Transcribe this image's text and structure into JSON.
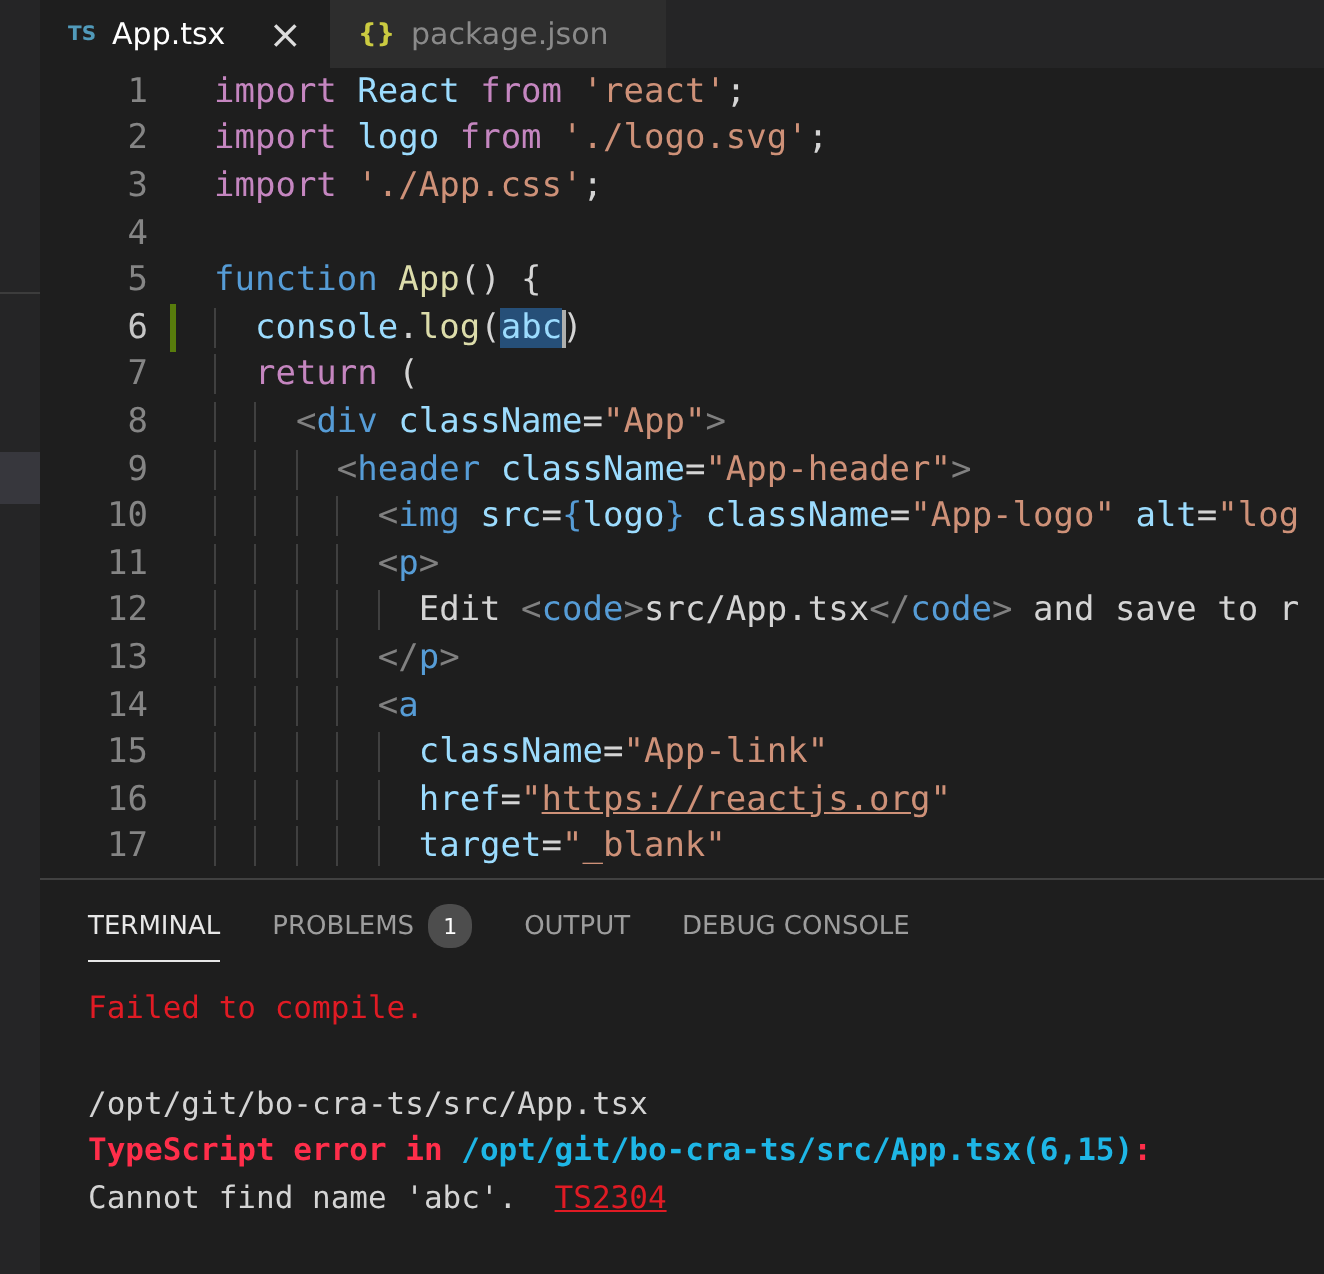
{
  "editor_tabs": [
    {
      "icon": "TS",
      "label": "App.tsx",
      "selected": true,
      "close": "×"
    },
    {
      "icon": "{}",
      "label": "package.json",
      "selected": false
    }
  ],
  "code_lines": [
    {
      "number": "1",
      "current": false,
      "modified": false,
      "tokens": [
        {
          "kind": "keyword",
          "text": "import"
        },
        {
          "kind": "variable",
          "text": " React"
        },
        {
          "kind": "keyword",
          "text": " from"
        },
        {
          "kind": "string",
          "text": " 'react'"
        },
        {
          "kind": "plain",
          "text": ";"
        }
      ]
    },
    {
      "number": "2",
      "current": false,
      "modified": false,
      "tokens": [
        {
          "kind": "keyword",
          "text": "import"
        },
        {
          "kind": "variable",
          "text": " logo"
        },
        {
          "kind": "keyword",
          "text": " from"
        },
        {
          "kind": "string",
          "text": " './logo.svg'"
        },
        {
          "kind": "plain",
          "text": ";"
        }
      ]
    },
    {
      "number": "3",
      "current": false,
      "modified": false,
      "tokens": [
        {
          "kind": "keyword",
          "text": "import"
        },
        {
          "kind": "string",
          "text": " './App.css'"
        },
        {
          "kind": "plain",
          "text": ";"
        }
      ]
    },
    {
      "number": "4",
      "current": false,
      "modified": false
    },
    {
      "number": "5",
      "current": false,
      "modified": false,
      "tokens": [
        {
          "kind": "storage",
          "text": "function"
        },
        {
          "kind": "function",
          "text": " App"
        },
        {
          "kind": "plain",
          "text": "() {"
        }
      ]
    },
    {
      "number": "6",
      "current": true,
      "modified": true,
      "tokens": [
        {
          "kind": "variable",
          "text": "  console"
        },
        {
          "kind": "plain",
          "text": "."
        },
        {
          "kind": "function",
          "text": "log"
        },
        {
          "kind": "plain",
          "text": "("
        },
        {
          "kind": "selection",
          "text": "abc"
        },
        {
          "kind": "plain",
          "text": ")"
        }
      ]
    },
    {
      "number": "7",
      "current": false,
      "modified": false,
      "tokens": [
        {
          "kind": "keyword",
          "text": "  return"
        },
        {
          "kind": "plain",
          "text": " ("
        }
      ]
    },
    {
      "number": "8",
      "current": false,
      "modified": false,
      "tokens": [
        {
          "kind": "punct",
          "text": "    <"
        },
        {
          "kind": "tag",
          "text": "div"
        },
        {
          "kind": "attr",
          "text": " className"
        },
        {
          "kind": "plain",
          "text": "="
        },
        {
          "kind": "string",
          "text": "\"App\""
        },
        {
          "kind": "punct",
          "text": ">"
        }
      ]
    },
    {
      "number": "9",
      "current": false,
      "modified": false,
      "tokens": [
        {
          "kind": "punct",
          "text": "      <"
        },
        {
          "kind": "tag",
          "text": "header"
        },
        {
          "kind": "attr",
          "text": " className"
        },
        {
          "kind": "plain",
          "text": "="
        },
        {
          "kind": "string",
          "text": "\"App-header\""
        },
        {
          "kind": "punct",
          "text": ">"
        }
      ]
    },
    {
      "number": "10",
      "current": false,
      "modified": false,
      "tokens": [
        {
          "kind": "punct",
          "text": "        <"
        },
        {
          "kind": "tag",
          "text": "img"
        },
        {
          "kind": "attr",
          "text": " src"
        },
        {
          "kind": "plain",
          "text": "="
        },
        {
          "kind": "tag",
          "text": "{"
        },
        {
          "kind": "variable",
          "text": "logo"
        },
        {
          "kind": "tag",
          "text": "}"
        },
        {
          "kind": "attr",
          "text": " className"
        },
        {
          "kind": "plain",
          "text": "="
        },
        {
          "kind": "string",
          "text": "\"App-logo\""
        },
        {
          "kind": "attr",
          "text": " alt"
        },
        {
          "kind": "plain",
          "text": "="
        },
        {
          "kind": "string",
          "text": "\"log"
        }
      ]
    },
    {
      "number": "11",
      "current": false,
      "modified": false,
      "tokens": [
        {
          "kind": "punct",
          "text": "        <"
        },
        {
          "kind": "tag",
          "text": "p"
        },
        {
          "kind": "punct",
          "text": ">"
        }
      ]
    },
    {
      "number": "12",
      "current": false,
      "modified": false,
      "tokens": [
        {
          "kind": "plain",
          "text": "          Edit "
        },
        {
          "kind": "punct",
          "text": "<"
        },
        {
          "kind": "tag",
          "text": "code"
        },
        {
          "kind": "punct",
          "text": ">"
        },
        {
          "kind": "plain",
          "text": "src/App.tsx"
        },
        {
          "kind": "punct",
          "text": "</"
        },
        {
          "kind": "tag",
          "text": "code"
        },
        {
          "kind": "punct",
          "text": ">"
        },
        {
          "kind": "plain",
          "text": " and save to r"
        }
      ]
    },
    {
      "number": "13",
      "current": false,
      "modified": false,
      "tokens": [
        {
          "kind": "punct",
          "text": "        </"
        },
        {
          "kind": "tag",
          "text": "p"
        },
        {
          "kind": "punct",
          "text": ">"
        }
      ]
    },
    {
      "number": "14",
      "current": false,
      "modified": false,
      "tokens": [
        {
          "kind": "punct",
          "text": "        <"
        },
        {
          "kind": "tag",
          "text": "a"
        }
      ]
    },
    {
      "number": "15",
      "current": false,
      "modified": false,
      "tokens": [
        {
          "kind": "attr",
          "text": "          className"
        },
        {
          "kind": "plain",
          "text": "="
        },
        {
          "kind": "string",
          "text": "\"App-link\""
        }
      ]
    },
    {
      "number": "16",
      "current": false,
      "modified": false,
      "tokens": [
        {
          "kind": "attr",
          "text": "          href"
        },
        {
          "kind": "plain",
          "text": "="
        },
        {
          "kind": "string",
          "text": "\""
        },
        {
          "kind": "link",
          "text": "https://reactjs.org"
        },
        {
          "kind": "string",
          "text": "\""
        }
      ]
    },
    {
      "number": "17",
      "current": false,
      "modified": false,
      "tokens": [
        {
          "kind": "attr",
          "text": "          target"
        },
        {
          "kind": "plain",
          "text": "="
        },
        {
          "kind": "string",
          "text": "\"_blank\""
        }
      ]
    }
  ],
  "panel_tabs": [
    {
      "label": "TERMINAL",
      "selected": true
    },
    {
      "label": "PROBLEMS",
      "selected": false,
      "badge": "1"
    },
    {
      "label": "OUTPUT",
      "selected": false
    },
    {
      "label": "DEBUG CONSOLE",
      "selected": false
    }
  ],
  "terminal_blocks": [
    {
      "lines": [
        {
          "segments": [
            {
              "kind": "error",
              "text": "Failed to compile."
            }
          ]
        }
      ]
    },
    {
      "lines": [
        {
          "segments": [
            {
              "kind": "plain",
              "text": "/opt/git/bo-cra-ts/src/App.tsx"
            }
          ]
        },
        {
          "segments": [
            {
              "kind": "error_bold",
              "text": "TypeScript error in "
            },
            {
              "kind": "path",
              "text": "/opt/git/bo-cra-ts/src/App.tsx(6,15)"
            },
            {
              "kind": "error_bold",
              "text": ":"
            }
          ]
        },
        {
          "segments": [
            {
              "kind": "plain",
              "text": "Cannot find name 'abc'.  "
            },
            {
              "kind": "code",
              "text": "TS2304"
            }
          ]
        }
      ]
    }
  ]
}
